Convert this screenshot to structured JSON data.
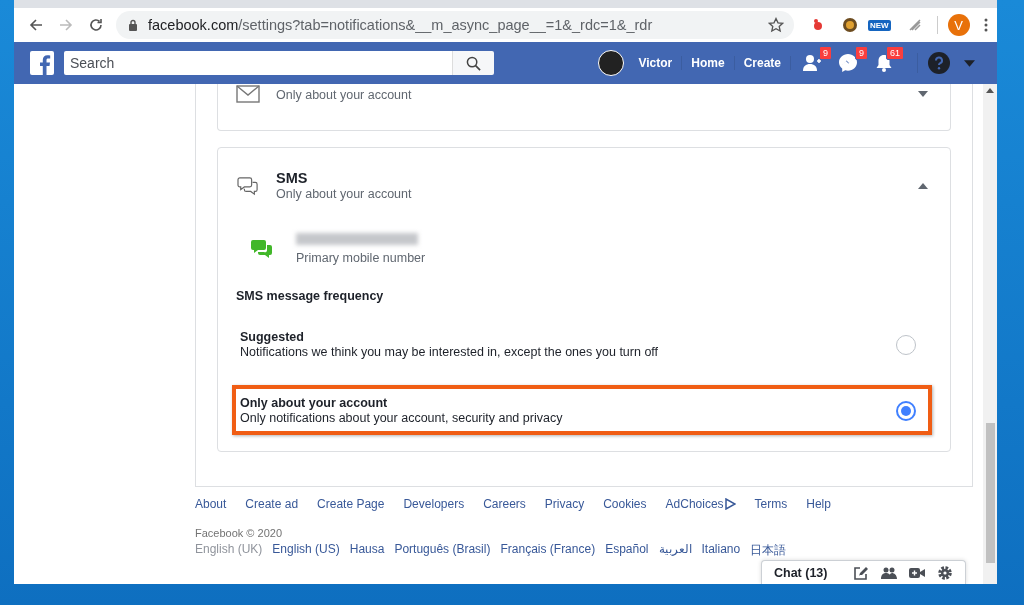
{
  "browser": {
    "url_host": "facebook.com",
    "url_path": "/settings?tab=notifications&__m_async_page__=1&_rdc=1&_rdr",
    "extension_badge": "NEW",
    "profile_initial": "V"
  },
  "topbar": {
    "search_placeholder": "Search",
    "user": "Victor",
    "links": [
      "Home",
      "Create"
    ],
    "notifications": [
      {
        "kind": "friends",
        "count": "9"
      },
      {
        "kind": "messages",
        "count": "9"
      },
      {
        "kind": "bell",
        "count": "61"
      }
    ]
  },
  "cards": [
    {
      "kind": "email",
      "subtitle": "Only about your account",
      "expanded": false
    },
    {
      "kind": "sms",
      "title": "SMS",
      "subtitle": "Only about your account",
      "expanded": true
    }
  ],
  "sms": {
    "number_caption": "Primary mobile number",
    "frequency_title": "SMS message frequency",
    "options": [
      {
        "title": "Suggested",
        "description": "Notifications we think you may be interested in, except the ones you turn off",
        "selected": false,
        "highlighted": false
      },
      {
        "title": "Only about your account",
        "description": "Only notifications about your account, security and privacy",
        "selected": true,
        "highlighted": true
      }
    ]
  },
  "footer": {
    "links": [
      "About",
      "Create ad",
      "Create Page",
      "Developers",
      "Careers",
      "Privacy",
      "Cookies",
      "AdChoices",
      "Terms",
      "Help"
    ],
    "copyright": "Facebook © 2020",
    "languages": [
      {
        "label": "English (UK)",
        "selected": true
      },
      {
        "label": "English (US)",
        "selected": false
      },
      {
        "label": "Hausa",
        "selected": false
      },
      {
        "label": "Português (Brasil)",
        "selected": false
      },
      {
        "label": "Français (France)",
        "selected": false
      },
      {
        "label": "Español",
        "selected": false
      },
      {
        "label": "العربية",
        "selected": false
      },
      {
        "label": "Italiano",
        "selected": false
      },
      {
        "label": "日本語",
        "selected": false
      }
    ]
  },
  "chat": {
    "label": "Chat (13)"
  }
}
